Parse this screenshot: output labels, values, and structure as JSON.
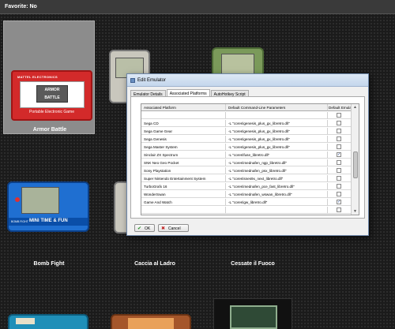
{
  "topbar": {
    "label": "Favorite: No"
  },
  "games": [
    {
      "name": "Armor Battle",
      "brand": "MATTEL ELECTRONICS",
      "logo_line1": "ARMOR",
      "logo_line2": "BATTLE",
      "tagline": "Portable Electronic Game"
    },
    {
      "name": "Bomb Fight",
      "strip": "MINI TIME & FUN",
      "small": "BOMB FIGHT"
    },
    {
      "name": "Caccia al Ladro"
    },
    {
      "name": "Cessate il Fuoco"
    }
  ],
  "dialog": {
    "title": "Edit Emulator",
    "tabs": [
      "Emulator Details",
      "Associated Platforms",
      "AutoHotkey Script"
    ],
    "columns": [
      "Associated Platform",
      "Default Command-Line Parameters",
      "Default Emulator"
    ],
    "rows": [
      {
        "platform": "",
        "params": "",
        "default": false
      },
      {
        "platform": "Sega CD",
        "params": "-L \"cores\\genesis_plus_gx_libretro.dll\"",
        "default": false
      },
      {
        "platform": "Sega Game Gear",
        "params": "-L \"cores\\genesis_plus_gx_libretro.dll\"",
        "default": false
      },
      {
        "platform": "Sega Genesis",
        "params": "-L \"cores\\genesis_plus_gx_libretro.dll\"",
        "default": false
      },
      {
        "platform": "Sega Master System",
        "params": "-L \"cores\\genesis_plus_gx_libretro.dll\"",
        "default": false
      },
      {
        "platform": "Sinclair ZX Spectrum",
        "params": "-L \"cores\\fuse_libretro.dll\"",
        "default": true
      },
      {
        "platform": "SNK Neo Geo Pocket",
        "params": "-L \"cores\\mednafen_ngp_libretro.dll\"",
        "default": false
      },
      {
        "platform": "Sony Playstation",
        "params": "-L \"cores\\mednafen_psx_libretro.dll\"",
        "default": false
      },
      {
        "platform": "Super Nintendo Entertainment System",
        "params": "-L \"cores\\snes9x_next_libretro.dll\"",
        "default": false
      },
      {
        "platform": "TurboGrafx 16",
        "params": "-L \"cores\\mednafen_pce_fast_libretro.dll\"",
        "default": false
      },
      {
        "platform": "WonderSwan",
        "params": "-L \"cores\\mednafen_wswan_libretro.dll\"",
        "default": false
      },
      {
        "platform": "Game And Watch",
        "params": "-L \"cores\\gw_libretro.dll\"",
        "default": true
      },
      {
        "platform": "",
        "params": "",
        "default": false
      }
    ],
    "ok_label": "OK",
    "cancel_label": "Cancel"
  },
  "colors": {
    "dialog_border": "#6d86a8",
    "selected_tile": "#8c8c8c",
    "armor_red": "#d32a2a"
  }
}
